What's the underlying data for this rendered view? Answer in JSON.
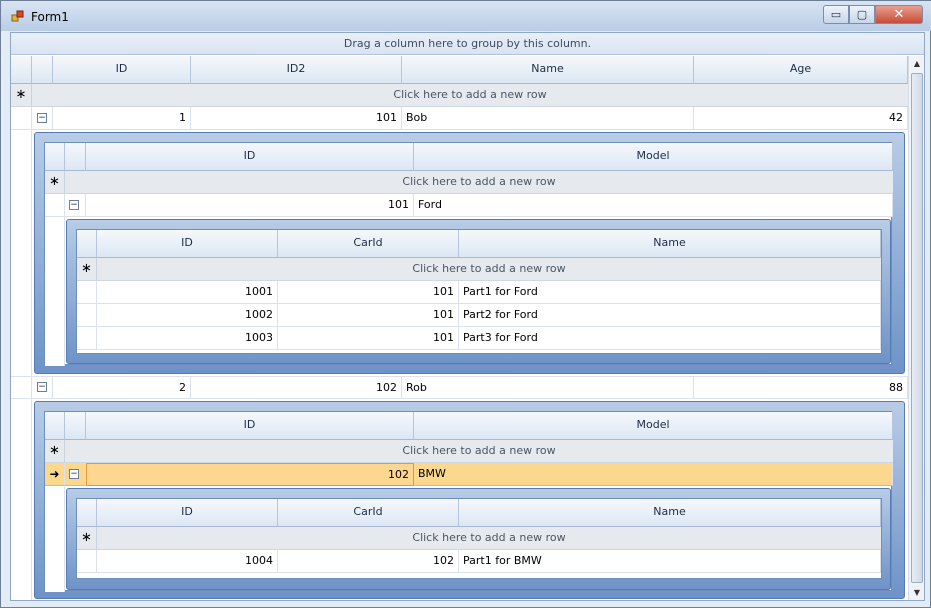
{
  "window": {
    "title": "Form1",
    "minimize": "▭",
    "maximize": "▢",
    "close": "✕"
  },
  "group_panel": "Drag a column here to group by this column.",
  "add_row_text": "Click here to add a new row",
  "icons": {
    "new_row": "∗",
    "expanded": "−",
    "current_row": "➜",
    "scroll_up": "▲",
    "scroll_down": "▼"
  },
  "master": {
    "columns": [
      "ID",
      "ID2",
      "Name",
      "Age"
    ],
    "rows": [
      {
        "id": "1",
        "id2": "101",
        "name": "Bob",
        "age": "42"
      },
      {
        "id": "2",
        "id2": "102",
        "name": "Rob",
        "age": "88"
      }
    ]
  },
  "cars1": {
    "columns": [
      "ID",
      "Model"
    ],
    "rows": [
      {
        "id": "101",
        "model": "Ford"
      }
    ]
  },
  "parts1": {
    "columns": [
      "ID",
      "CarId",
      "Name"
    ],
    "rows": [
      {
        "id": "1001",
        "carid": "101",
        "name": "Part1 for Ford"
      },
      {
        "id": "1002",
        "carid": "101",
        "name": "Part2 for Ford"
      },
      {
        "id": "1003",
        "carid": "101",
        "name": "Part3 for Ford"
      }
    ]
  },
  "cars2": {
    "columns": [
      "ID",
      "Model"
    ],
    "rows": [
      {
        "id": "102",
        "model": "BMW"
      }
    ]
  },
  "parts2": {
    "columns": [
      "ID",
      "CarId",
      "Name"
    ],
    "rows": [
      {
        "id": "1004",
        "carid": "102",
        "name": "Part1 for BMW"
      }
    ]
  }
}
